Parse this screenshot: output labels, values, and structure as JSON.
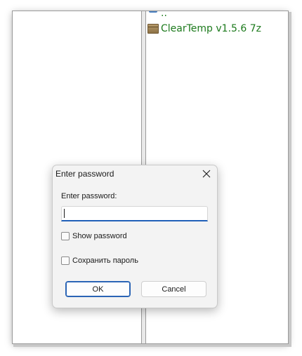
{
  "file_list": {
    "items": [
      {
        "icon": "parent-folder-icon",
        "name": ".."
      },
      {
        "icon": "archive-icon",
        "name": "ClearTemp v1.5.6 7z"
      }
    ]
  },
  "dialog": {
    "title": "Enter password",
    "field_label": "Enter password:",
    "password_value": "",
    "show_password_label": "Show password",
    "save_password_label": "Сохранить пароль",
    "ok_label": "OK",
    "cancel_label": "Cancel",
    "close_icon": "close-icon"
  },
  "colors": {
    "file_text": "#1c7a1c",
    "input_focus": "#1f5fb8",
    "ok_border": "#2a64b5"
  }
}
